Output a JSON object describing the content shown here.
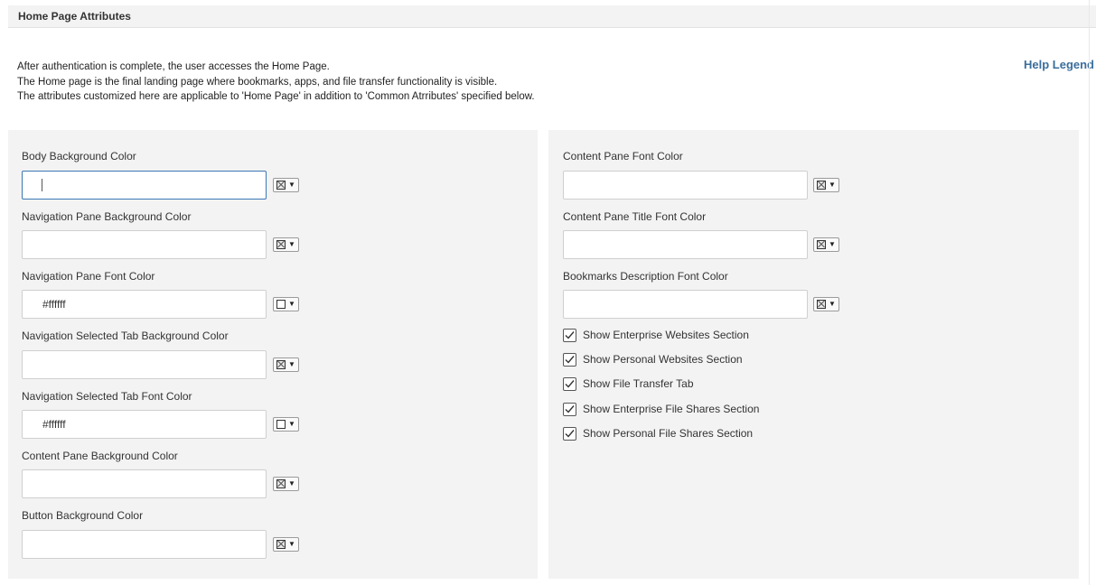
{
  "section": {
    "title": "Home Page Attributes"
  },
  "help_legend": "Help Legend",
  "intro": {
    "line1": "After authentication is complete, the user accesses the Home Page.",
    "line2": "The Home page is the final landing page where bookmarks, apps, and file transfer functionality is visible.",
    "line3": "The attributes customized here are applicable to 'Home Page' in addition to 'Common Atrributes' specified below."
  },
  "left": {
    "body_bg": {
      "label": "Body Background Color",
      "value": ""
    },
    "nav_bg": {
      "label": "Navigation Pane Background Color",
      "value": ""
    },
    "nav_font": {
      "label": "Navigation Pane Font Color",
      "value": "#ffffff"
    },
    "nav_sel_bg": {
      "label": "Navigation Selected Tab Background Color",
      "value": ""
    },
    "nav_sel_font": {
      "label": "Navigation Selected Tab Font Color",
      "value": "#ffffff"
    },
    "content_bg": {
      "label": "Content Pane Background Color",
      "value": ""
    },
    "button_bg": {
      "label": "Button Background Color",
      "value": ""
    }
  },
  "right": {
    "content_font": {
      "label": "Content Pane Font Color",
      "value": ""
    },
    "content_title_font": {
      "label": "Content Pane Title Font Color",
      "value": ""
    },
    "bookmarks_desc_font": {
      "label": "Bookmarks Description Font Color",
      "value": ""
    },
    "checkboxes": [
      {
        "label": "Show Enterprise Websites Section",
        "checked": true
      },
      {
        "label": "Show Personal Websites Section",
        "checked": true
      },
      {
        "label": "Show File Transfer Tab",
        "checked": true
      },
      {
        "label": "Show Enterprise File Shares Section",
        "checked": true
      },
      {
        "label": "Show Personal File Shares Section",
        "checked": true
      }
    ]
  },
  "colors": {
    "panel_bg": "#f3f3f3",
    "link": "#3a6e9c",
    "focus_border": "#3a78b5"
  }
}
